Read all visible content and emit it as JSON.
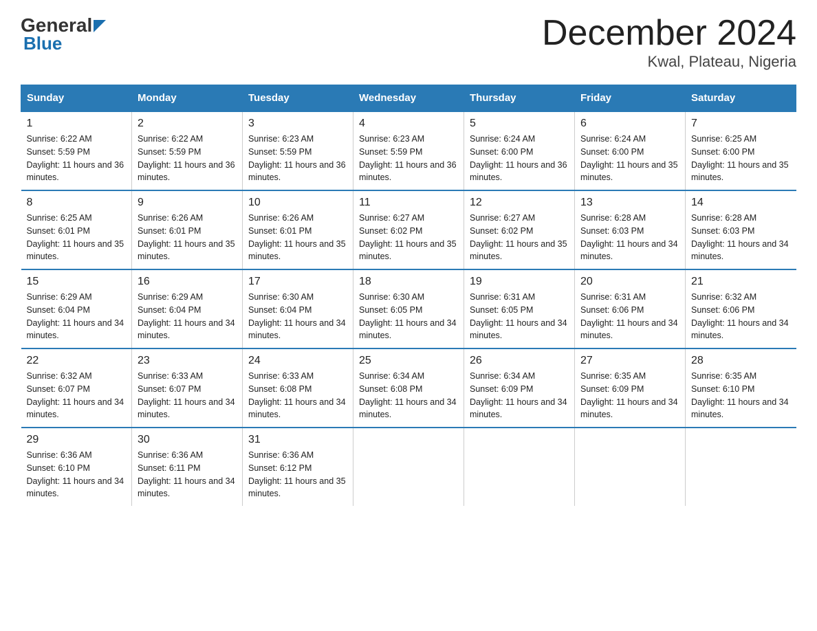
{
  "logo": {
    "general": "General",
    "blue_suffix": "Blue",
    "underline": "Blue"
  },
  "header": {
    "title": "December 2024",
    "subtitle": "Kwal, Plateau, Nigeria"
  },
  "weekdays": [
    "Sunday",
    "Monday",
    "Tuesday",
    "Wednesday",
    "Thursday",
    "Friday",
    "Saturday"
  ],
  "weeks": [
    [
      {
        "day": "1",
        "sunrise": "6:22 AM",
        "sunset": "5:59 PM",
        "daylight": "11 hours and 36 minutes."
      },
      {
        "day": "2",
        "sunrise": "6:22 AM",
        "sunset": "5:59 PM",
        "daylight": "11 hours and 36 minutes."
      },
      {
        "day": "3",
        "sunrise": "6:23 AM",
        "sunset": "5:59 PM",
        "daylight": "11 hours and 36 minutes."
      },
      {
        "day": "4",
        "sunrise": "6:23 AM",
        "sunset": "5:59 PM",
        "daylight": "11 hours and 36 minutes."
      },
      {
        "day": "5",
        "sunrise": "6:24 AM",
        "sunset": "6:00 PM",
        "daylight": "11 hours and 36 minutes."
      },
      {
        "day": "6",
        "sunrise": "6:24 AM",
        "sunset": "6:00 PM",
        "daylight": "11 hours and 35 minutes."
      },
      {
        "day": "7",
        "sunrise": "6:25 AM",
        "sunset": "6:00 PM",
        "daylight": "11 hours and 35 minutes."
      }
    ],
    [
      {
        "day": "8",
        "sunrise": "6:25 AM",
        "sunset": "6:01 PM",
        "daylight": "11 hours and 35 minutes."
      },
      {
        "day": "9",
        "sunrise": "6:26 AM",
        "sunset": "6:01 PM",
        "daylight": "11 hours and 35 minutes."
      },
      {
        "day": "10",
        "sunrise": "6:26 AM",
        "sunset": "6:01 PM",
        "daylight": "11 hours and 35 minutes."
      },
      {
        "day": "11",
        "sunrise": "6:27 AM",
        "sunset": "6:02 PM",
        "daylight": "11 hours and 35 minutes."
      },
      {
        "day": "12",
        "sunrise": "6:27 AM",
        "sunset": "6:02 PM",
        "daylight": "11 hours and 35 minutes."
      },
      {
        "day": "13",
        "sunrise": "6:28 AM",
        "sunset": "6:03 PM",
        "daylight": "11 hours and 34 minutes."
      },
      {
        "day": "14",
        "sunrise": "6:28 AM",
        "sunset": "6:03 PM",
        "daylight": "11 hours and 34 minutes."
      }
    ],
    [
      {
        "day": "15",
        "sunrise": "6:29 AM",
        "sunset": "6:04 PM",
        "daylight": "11 hours and 34 minutes."
      },
      {
        "day": "16",
        "sunrise": "6:29 AM",
        "sunset": "6:04 PM",
        "daylight": "11 hours and 34 minutes."
      },
      {
        "day": "17",
        "sunrise": "6:30 AM",
        "sunset": "6:04 PM",
        "daylight": "11 hours and 34 minutes."
      },
      {
        "day": "18",
        "sunrise": "6:30 AM",
        "sunset": "6:05 PM",
        "daylight": "11 hours and 34 minutes."
      },
      {
        "day": "19",
        "sunrise": "6:31 AM",
        "sunset": "6:05 PM",
        "daylight": "11 hours and 34 minutes."
      },
      {
        "day": "20",
        "sunrise": "6:31 AM",
        "sunset": "6:06 PM",
        "daylight": "11 hours and 34 minutes."
      },
      {
        "day": "21",
        "sunrise": "6:32 AM",
        "sunset": "6:06 PM",
        "daylight": "11 hours and 34 minutes."
      }
    ],
    [
      {
        "day": "22",
        "sunrise": "6:32 AM",
        "sunset": "6:07 PM",
        "daylight": "11 hours and 34 minutes."
      },
      {
        "day": "23",
        "sunrise": "6:33 AM",
        "sunset": "6:07 PM",
        "daylight": "11 hours and 34 minutes."
      },
      {
        "day": "24",
        "sunrise": "6:33 AM",
        "sunset": "6:08 PM",
        "daylight": "11 hours and 34 minutes."
      },
      {
        "day": "25",
        "sunrise": "6:34 AM",
        "sunset": "6:08 PM",
        "daylight": "11 hours and 34 minutes."
      },
      {
        "day": "26",
        "sunrise": "6:34 AM",
        "sunset": "6:09 PM",
        "daylight": "11 hours and 34 minutes."
      },
      {
        "day": "27",
        "sunrise": "6:35 AM",
        "sunset": "6:09 PM",
        "daylight": "11 hours and 34 minutes."
      },
      {
        "day": "28",
        "sunrise": "6:35 AM",
        "sunset": "6:10 PM",
        "daylight": "11 hours and 34 minutes."
      }
    ],
    [
      {
        "day": "29",
        "sunrise": "6:36 AM",
        "sunset": "6:10 PM",
        "daylight": "11 hours and 34 minutes."
      },
      {
        "day": "30",
        "sunrise": "6:36 AM",
        "sunset": "6:11 PM",
        "daylight": "11 hours and 34 minutes."
      },
      {
        "day": "31",
        "sunrise": "6:36 AM",
        "sunset": "6:12 PM",
        "daylight": "11 hours and 35 minutes."
      },
      null,
      null,
      null,
      null
    ]
  ]
}
